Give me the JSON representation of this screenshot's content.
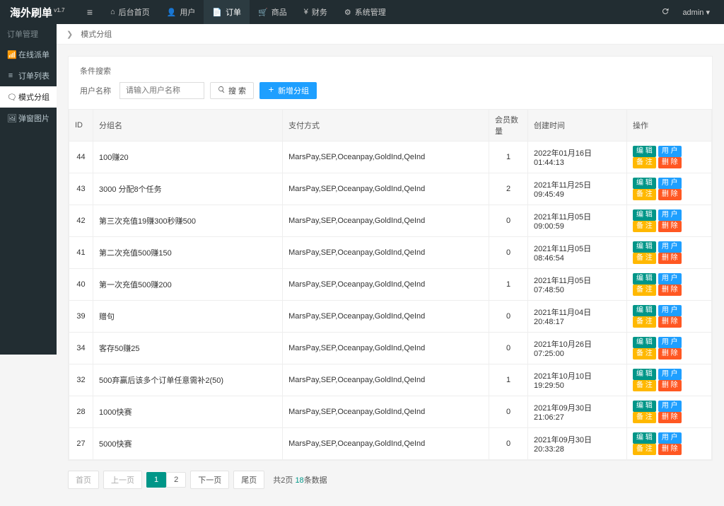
{
  "brand": {
    "name": "海外刷单",
    "version": "v1.7"
  },
  "header": {
    "toggle_icon": "≡",
    "tabs": [
      {
        "icon": "⌂",
        "label": "后台首页"
      },
      {
        "icon": "👤",
        "label": "用户"
      },
      {
        "icon": "📄",
        "label": "订单",
        "active": true
      },
      {
        "icon": "🛒",
        "label": "商品"
      },
      {
        "icon": "¥",
        "label": "财务"
      },
      {
        "icon": "⚙",
        "label": "系统管理"
      }
    ],
    "admin": {
      "name": "admin",
      "caret": "▾"
    }
  },
  "sidebar": {
    "group_label": "订单管理",
    "items": [
      {
        "icon": "📶",
        "label": "在线派单"
      },
      {
        "icon": "≡",
        "label": "订单列表"
      },
      {
        "icon": "🗨",
        "label": "模式分组",
        "active": true
      },
      {
        "icon": "🖼",
        "label": "弹窗图片"
      }
    ]
  },
  "breadcrumb": {
    "chevron": "❯",
    "label": "模式分组"
  },
  "search": {
    "panel_title": "条件搜索",
    "field_label": "用户名称",
    "placeholder": "请输入用户名称",
    "search_label": "搜 索",
    "new_label": "新增分组"
  },
  "table": {
    "headers": {
      "id": "ID",
      "name": "分组名",
      "paytype": "支付方式",
      "count": "会员数量",
      "time": "创建时间",
      "ops": "操作"
    },
    "op_labels": {
      "edit": "编 辑",
      "user": "用 户",
      "remark": "备 注",
      "delete": "删 除"
    },
    "rows": [
      {
        "id": "44",
        "name": "100赚20",
        "paytype": "MarsPay,SEP,Oceanpay,GoldInd,QeInd",
        "count": "1",
        "time": "2022年01月16日 01:44:13"
      },
      {
        "id": "43",
        "name": "3000 分配8个任务",
        "paytype": "MarsPay,SEP,Oceanpay,GoldInd,QeInd",
        "count": "2",
        "time": "2021年11月25日 09:45:49"
      },
      {
        "id": "42",
        "name": "第三次充值19赚300秒赚500",
        "paytype": "MarsPay,SEP,Oceanpay,GoldInd,QeInd",
        "count": "0",
        "time": "2021年11月05日 09:00:59"
      },
      {
        "id": "41",
        "name": "第二次充值500赚150",
        "paytype": "MarsPay,SEP,Oceanpay,GoldInd,QeInd",
        "count": "0",
        "time": "2021年11月05日 08:46:54"
      },
      {
        "id": "40",
        "name": "第一次充值500赚200",
        "paytype": "MarsPay,SEP,Oceanpay,GoldInd,QeInd",
        "count": "1",
        "time": "2021年11月05日 07:48:50"
      },
      {
        "id": "39",
        "name": "赠句",
        "paytype": "MarsPay,SEP,Oceanpay,GoldInd,QeInd",
        "count": "0",
        "time": "2021年11月04日 20:48:17"
      },
      {
        "id": "34",
        "name": "客存50赚25",
        "paytype": "MarsPay,SEP,Oceanpay,GoldInd,QeInd",
        "count": "0",
        "time": "2021年10月26日 07:25:00"
      },
      {
        "id": "32",
        "name": "500弃赢后该多个订单任意需补2(50)",
        "paytype": "MarsPay,SEP,Oceanpay,GoldInd,QeInd",
        "count": "1",
        "time": "2021年10月10日 19:29:50"
      },
      {
        "id": "28",
        "name": "1000快赛",
        "paytype": "MarsPay,SEP,Oceanpay,GoldInd,QeInd",
        "count": "0",
        "time": "2021年09月30日 21:06:27"
      },
      {
        "id": "27",
        "name": "5000快赛",
        "paytype": "MarsPay,SEP,Oceanpay,GoldInd,QeInd",
        "count": "0",
        "time": "2021年09月30日 20:33:28"
      }
    ]
  },
  "pager": {
    "first": "首页",
    "prev": "上一页",
    "pages": [
      "1",
      "2"
    ],
    "active_index": 0,
    "next": "下一页",
    "last": "尾页",
    "total_prefix": "共2页 ",
    "total_count": "18",
    "total_suffix": "条数据"
  }
}
